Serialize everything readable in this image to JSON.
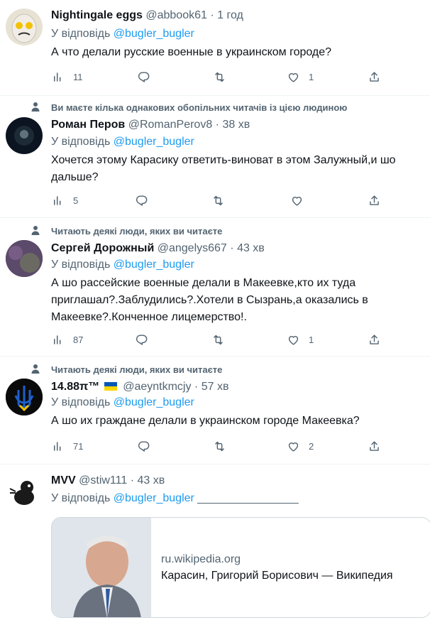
{
  "tweets": [
    {
      "name": "Nightingale eggs",
      "handle": "@abbook61",
      "time": "1 год",
      "reply_prefix": "У відповідь",
      "reply_to": "@bugler_bugler",
      "text": "А что делали русские военные в украинском городе?",
      "replies": "11",
      "retweets": "",
      "likes": "1"
    },
    {
      "social": "Ви маєте кілька однакових обопільних читачів із цією людиною",
      "name": "Роман Перов",
      "handle": "@RomanPerov8",
      "time": "38 хв",
      "reply_prefix": "У відповідь",
      "reply_to": "@bugler_bugler",
      "text": "Хочется этому Карасику ответить-виноват в этом Залужный,и шо дальше?",
      "replies": "5",
      "retweets": "",
      "likes": ""
    },
    {
      "social": "Читають деякі люди, яких ви читаєте",
      "name": "Сергей Дорожный",
      "handle": "@angelys667",
      "time": "43 хв",
      "reply_prefix": "У відповідь",
      "reply_to": "@bugler_bugler",
      "text": "А шо рассейские военные делали в Макеевке,кто их туда приглашал?.Заблудились?.Хотели в Сызрань,а оказались в Макеевке?.Конченное лицемерство!.",
      "replies": "87",
      "retweets": "",
      "likes": "1"
    },
    {
      "social": "Читають деякі люди, яких ви читаєте",
      "name": "14.88π™",
      "handle": "@aeyntkmcjy",
      "time": "57 хв",
      "reply_prefix": "У відповідь",
      "reply_to": "@bugler_bugler",
      "text": "А шо их граждане делали в украинском городе Макеевка?",
      "replies": "71",
      "retweets": "",
      "likes": "2"
    },
    {
      "name": "MVV",
      "handle": "@stiw111",
      "time": "43 хв",
      "reply_prefix": "У відповідь",
      "reply_to": "@bugler_bugler",
      "reply_suffix": "________________",
      "card": {
        "domain": "ru.wikipedia.org",
        "title": "Карасин, Григорий Борисович — Википедия"
      }
    }
  ],
  "separator": "·",
  "colors": {
    "link": "#1d9bf0",
    "secondary": "#536471",
    "border": "#eff3f4",
    "flag_blue": "#0057b7",
    "flag_yellow": "#ffd700"
  },
  "icons": [
    "reply-icon",
    "retweet-icon",
    "like-icon",
    "share-icon",
    "person-icon"
  ]
}
